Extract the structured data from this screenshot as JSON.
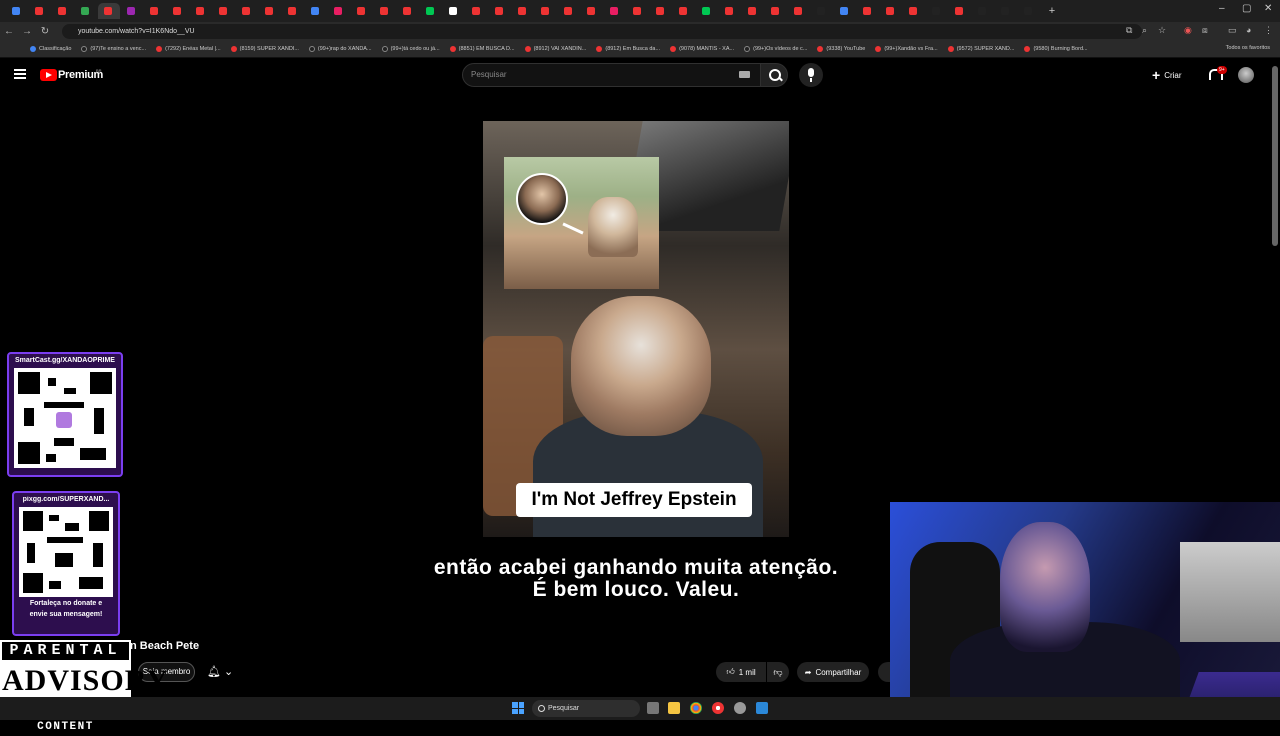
{
  "browser": {
    "url": "youtube.com/watch?v=I1K6Ndo__VU",
    "bookmarks": [
      "Classificação",
      "(97)Te ensino a venc...",
      "(7292) Enéas Metal |...",
      "(8159) SUPER XANDI...",
      "(99+)rap do XANDA...",
      "(99+)tá cedo ou já...",
      "(8851) EM BUSCA D...",
      "(8912) VAI XANDIN...",
      "(8912) Em Busca da...",
      "(9078) MANTIS - XA...",
      "(99+)Os vídeos de c...",
      "(9338) YouTube",
      "(99+)Xandão vs Fra...",
      "(9572) SUPER XAND...",
      "(9580) Burning Bord..."
    ],
    "bookmarks_right": "Todos os favoritos"
  },
  "youtube": {
    "logo_label": "Premium",
    "region": "BR",
    "search_placeholder": "Pesquisar",
    "create_label": "Criar",
    "notification_badge": "9+"
  },
  "video": {
    "caption_on_video": "I'm Not Jeffrey Epstein",
    "subtitle_line1": "então acabei ganhando muita atenção.",
    "subtitle_line2": "É bem louco. Valeu.",
    "title_partial": "n Beach Pete",
    "join_label": "Seja membro",
    "likes": "1 mil",
    "share_label": "Compartilhar"
  },
  "overlays": {
    "qr1_label": "SmartCast.gg/XANDAOPRIME",
    "qr2_label": "pixgg.com/SUPERXAND...",
    "qr2_note_line1": "Fortaleça no donate e",
    "qr2_note_line2": "envie sua mensagem!",
    "advisory_top": "PARENTAL",
    "advisory_mid": "ADVISORY",
    "advisory_bot": "EXPLICIT CONTENT"
  },
  "taskbar": {
    "search_label": "Pesquisar"
  },
  "colors": {
    "youtube_red": "#ff0000",
    "overlay_purple": "#7b3ef0",
    "background": "#000000"
  }
}
